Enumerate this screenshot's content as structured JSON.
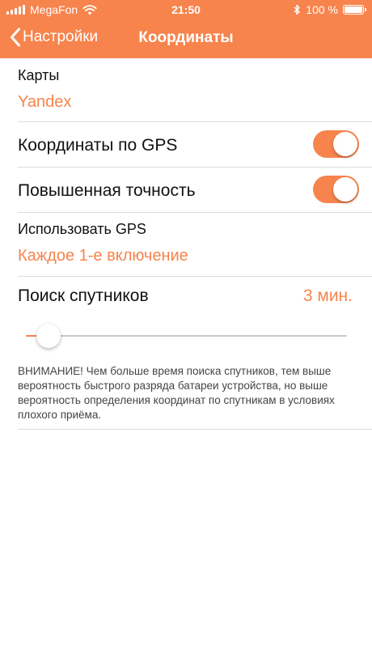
{
  "status_bar": {
    "carrier": "MegaFon",
    "time": "21:50",
    "battery_text": "100 %",
    "battery_level": 1.0,
    "icons": [
      "signal-bars-icon",
      "wifi-icon",
      "bluetooth-icon",
      "battery-icon"
    ]
  },
  "nav": {
    "back_label": "Настройки",
    "title": "Координаты"
  },
  "settings": {
    "maps": {
      "label": "Карты",
      "value": "Yandex"
    },
    "gps_coords": {
      "label": "Координаты по GPS",
      "enabled": true
    },
    "high_accuracy": {
      "label": "Повышенная точность",
      "enabled": true
    },
    "use_gps": {
      "label": "Использовать GPS",
      "value": "Каждое 1-е включение"
    },
    "satellite_search": {
      "label": "Поиск спутников",
      "value": "3 мин.",
      "slider_fraction": 0.07
    },
    "warning": "ВНИМАНИЕ! Чем больше время поиска спутников, тем выше вероятность быстрого разряда батареи устройства, но выше вероятность определения координат по спутникам в условиях плохого приёма."
  },
  "colors": {
    "accent": "#f7844d",
    "separator": "#dcdcdc",
    "track": "#c8c8c8"
  }
}
